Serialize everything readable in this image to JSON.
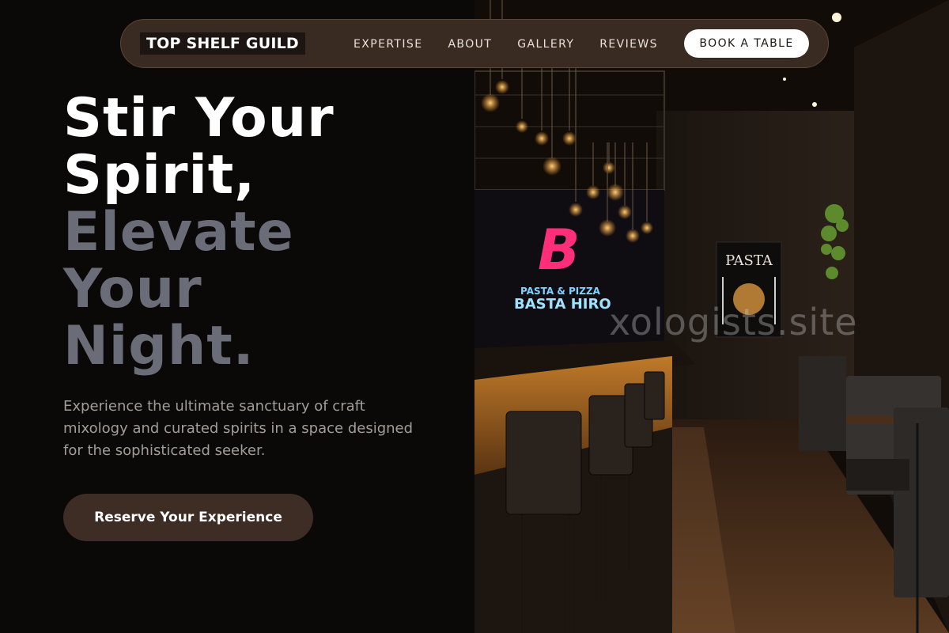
{
  "brand": {
    "logo_text": "TOP SHELF GUILD"
  },
  "nav": {
    "links": [
      {
        "label": "EXPERTISE"
      },
      {
        "label": "ABOUT"
      },
      {
        "label": "GALLERY"
      },
      {
        "label": "REVIEWS"
      }
    ],
    "cta_label": "BOOK A TABLE"
  },
  "hero": {
    "title_white": [
      "Stir Your",
      "Spirit,"
    ],
    "title_grey": [
      "Elevate",
      "Your",
      "Night."
    ],
    "subtitle": "Experience the ultimate sanctuary of craft mixology and curated spirits in a space designed for the sophisticated seeker.",
    "cta_label": "Reserve Your Experience"
  },
  "photo": {
    "neon_sign_top": "PASTA & PIZZA",
    "neon_sign_main": "BASTA HIRO",
    "neon_letter": "B",
    "poster_title": "PASTA",
    "watermark": "xologists.site"
  },
  "colors": {
    "background": "#0b0908",
    "nav_bg": "#3a2b22",
    "title_white": "#ffffff",
    "title_grey": "#6a6c78",
    "cta_bg": "#3e2d24",
    "neon_pink": "#ff2e7a",
    "neon_blue": "#7fd4ff"
  }
}
